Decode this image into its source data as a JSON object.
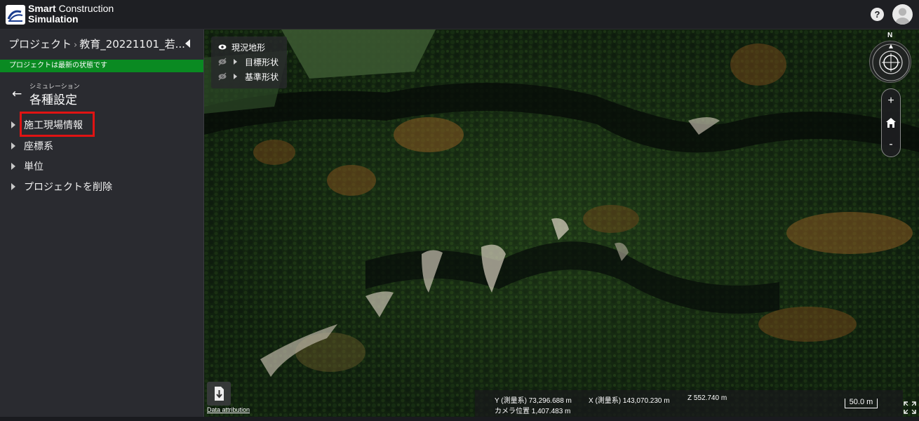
{
  "app": {
    "name_bold": "Smart",
    "name_rest": " Construction",
    "name_line2": "Simulation"
  },
  "header": {
    "help_label": "?"
  },
  "sidebar": {
    "breadcrumb": {
      "root": "プロジェクト",
      "separator": "›",
      "current": "教育_20221101_若..."
    },
    "status": "プロジェクトは最新の状態です",
    "subtitle": "シミュレーション",
    "title": "各種設定",
    "items": [
      {
        "label": "施工現場情報"
      },
      {
        "label": "座標系"
      },
      {
        "label": "単位"
      },
      {
        "label": "プロジェクトを削除"
      }
    ]
  },
  "map": {
    "layers": [
      {
        "label": "現況地形",
        "visible": true
      },
      {
        "label": "目標形状",
        "visible": false
      },
      {
        "label": "基準形状",
        "visible": false
      }
    ],
    "compass_label": "N",
    "zoom_in": "+",
    "zoom_out": "-",
    "attribution": "Data attribution",
    "coords": {
      "y": "Y (測量系) 73,296.688 m",
      "x": "X (測量系) 143,070.230 m",
      "z": "Z 552.740 m",
      "camera": "カメラ位置 1,407.483 m"
    },
    "scale": "50.0 m"
  },
  "colors": {
    "status_green": "#0a8a22",
    "highlight_red": "#e01313",
    "sidebar_bg": "#2a2b30"
  }
}
